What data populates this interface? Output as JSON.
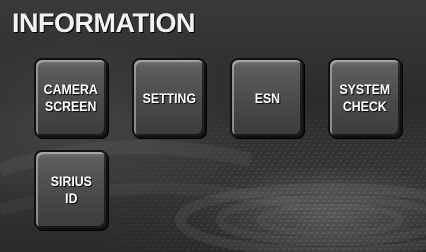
{
  "header": {
    "title": "INFORMATION"
  },
  "buttons": [
    {
      "id": "camera-screen",
      "label": "CAMERA\nSCREEN"
    },
    {
      "id": "setting",
      "label": "SETTING"
    },
    {
      "id": "esn",
      "label": "ESN"
    },
    {
      "id": "system-check",
      "label": "SYSTEM\nCHECK"
    },
    {
      "id": "sirius-id",
      "label": "SIRIUS\nID"
    }
  ],
  "colors": {
    "background": "#2f2f2f",
    "button_face": "#4a4a4a",
    "text": "#ffffff"
  }
}
